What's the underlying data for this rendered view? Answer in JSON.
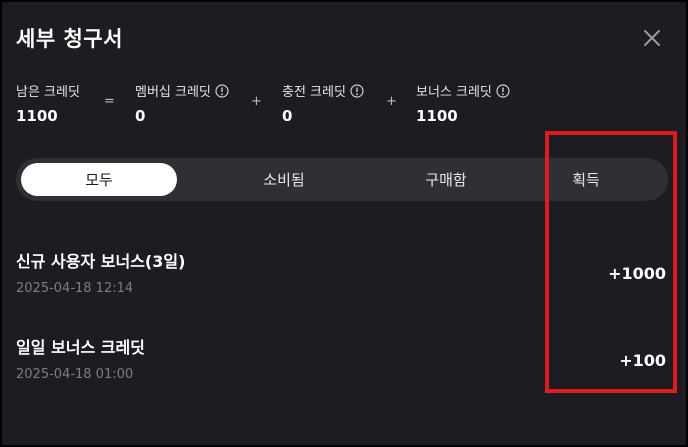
{
  "dialog": {
    "title": "세부 청구서",
    "close_icon": "close-icon"
  },
  "credits": {
    "remaining": {
      "label": "남은 크레딧",
      "value": "1100"
    },
    "equals": "=",
    "membership": {
      "label": "멤버십 크레딧",
      "value": "0",
      "icon": "info-icon"
    },
    "plus1": "+",
    "charged": {
      "label": "충전 크레딧",
      "value": "0",
      "icon": "info-icon"
    },
    "plus2": "+",
    "bonus": {
      "label": "보너스 크레딧",
      "value": "1100",
      "icon": "info-icon"
    }
  },
  "tabs": [
    {
      "label": "모두",
      "active": true
    },
    {
      "label": "소비됨",
      "active": false
    },
    {
      "label": "구매함",
      "active": false
    },
    {
      "label": "획득",
      "active": false
    }
  ],
  "transactions": [
    {
      "title": "신규 사용자 보너스(3일)",
      "date": "2025-04-18 12:14",
      "amount": "+1000"
    },
    {
      "title": "일일 보너스 크레딧",
      "date": "2025-04-18 01:00",
      "amount": "+100"
    }
  ],
  "colors": {
    "background": "#1c1c22",
    "tab_bar": "#2f2f35",
    "active_tab": "#ffffff",
    "annotation_box": "#e01b1b"
  }
}
